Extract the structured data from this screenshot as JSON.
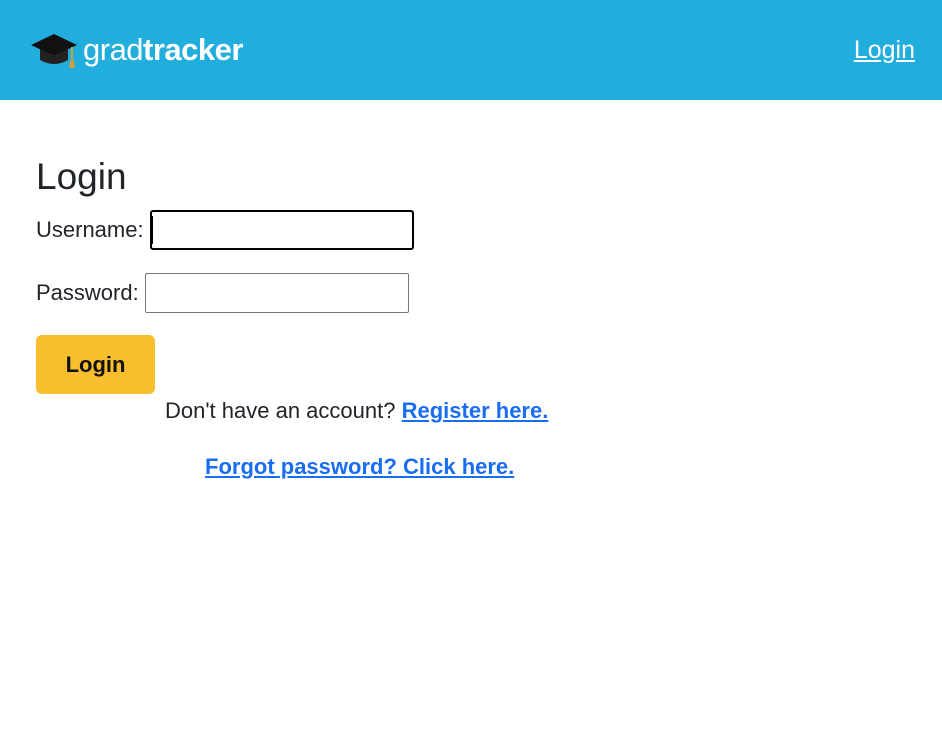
{
  "header": {
    "logo_grad": "grad",
    "logo_tracker": "tracker",
    "nav_login": "Login",
    "background_color": "#22aedd"
  },
  "main": {
    "title": "Login",
    "username_label": "Username:",
    "username_value": "",
    "password_label": "Password:",
    "password_value": "",
    "login_button": "Login",
    "register_prompt": "Don't have an account?",
    "register_link": "Register here.",
    "forgot_link": "Forgot password? Click here."
  },
  "colors": {
    "button": "#f9be2e",
    "link": "#1a6df0"
  },
  "icons": {
    "logo": "graduation-cap-icon"
  }
}
